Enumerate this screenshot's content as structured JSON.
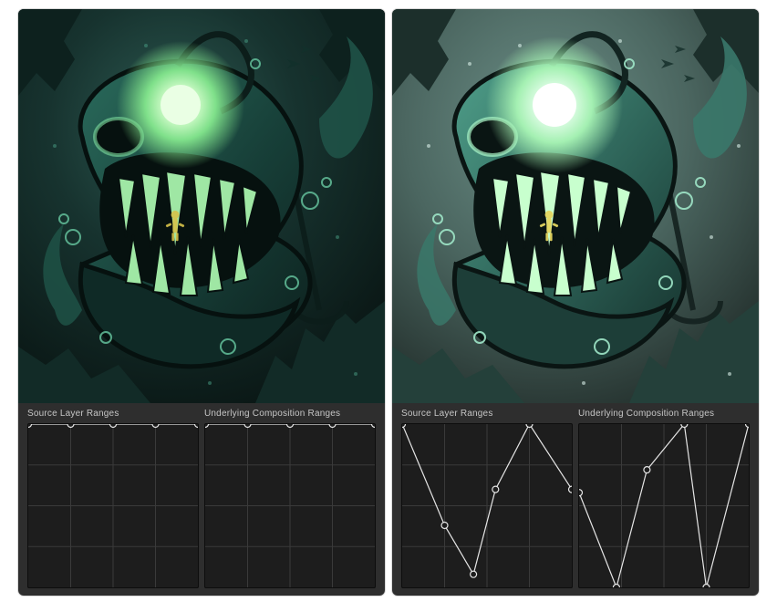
{
  "labels": {
    "source": "Source Layer Ranges",
    "underlying": "Underlying Composition Ranges"
  },
  "domain": {
    "x": [
      0,
      100
    ],
    "y": [
      0,
      100
    ]
  },
  "panels": [
    {
      "id": "left",
      "image_variant": "dark",
      "source_curve": [
        [
          0,
          100
        ],
        [
          25,
          100
        ],
        [
          50,
          100
        ],
        [
          75,
          100
        ],
        [
          100,
          100
        ]
      ],
      "underlying_curve": [
        [
          0,
          100
        ],
        [
          25,
          100
        ],
        [
          50,
          100
        ],
        [
          75,
          100
        ],
        [
          100,
          100
        ]
      ]
    },
    {
      "id": "right",
      "image_variant": "bright",
      "source_curve": [
        [
          0,
          100
        ],
        [
          25,
          38
        ],
        [
          42,
          8
        ],
        [
          55,
          60
        ],
        [
          75,
          100
        ],
        [
          100,
          60
        ]
      ],
      "underlying_curve": [
        [
          0,
          58
        ],
        [
          22,
          0
        ],
        [
          40,
          72
        ],
        [
          62,
          100
        ],
        [
          75,
          0
        ],
        [
          100,
          100
        ]
      ]
    }
  ],
  "chart_data": [
    {
      "type": "line",
      "title": "Source Layer Ranges",
      "panel": "left",
      "xlabel": "",
      "ylabel": "",
      "xlim": [
        0,
        100
      ],
      "ylim": [
        0,
        100
      ],
      "series": [
        {
          "name": "source",
          "x": [
            0,
            25,
            50,
            75,
            100
          ],
          "y": [
            100,
            100,
            100,
            100,
            100
          ]
        }
      ]
    },
    {
      "type": "line",
      "title": "Underlying Composition Ranges",
      "panel": "left",
      "xlabel": "",
      "ylabel": "",
      "xlim": [
        0,
        100
      ],
      "ylim": [
        0,
        100
      ],
      "series": [
        {
          "name": "underlying",
          "x": [
            0,
            25,
            50,
            75,
            100
          ],
          "y": [
            100,
            100,
            100,
            100,
            100
          ]
        }
      ]
    },
    {
      "type": "line",
      "title": "Source Layer Ranges",
      "panel": "right",
      "xlabel": "",
      "ylabel": "",
      "xlim": [
        0,
        100
      ],
      "ylim": [
        0,
        100
      ],
      "series": [
        {
          "name": "source",
          "x": [
            0,
            25,
            42,
            55,
            75,
            100
          ],
          "y": [
            100,
            38,
            8,
            60,
            100,
            60
          ]
        }
      ]
    },
    {
      "type": "line",
      "title": "Underlying Composition Ranges",
      "panel": "right",
      "xlabel": "",
      "ylabel": "",
      "xlim": [
        0,
        100
      ],
      "ylim": [
        0,
        100
      ],
      "series": [
        {
          "name": "underlying",
          "x": [
            0,
            22,
            40,
            62,
            75,
            100
          ],
          "y": [
            58,
            0,
            72,
            100,
            0,
            100
          ]
        }
      ]
    }
  ]
}
